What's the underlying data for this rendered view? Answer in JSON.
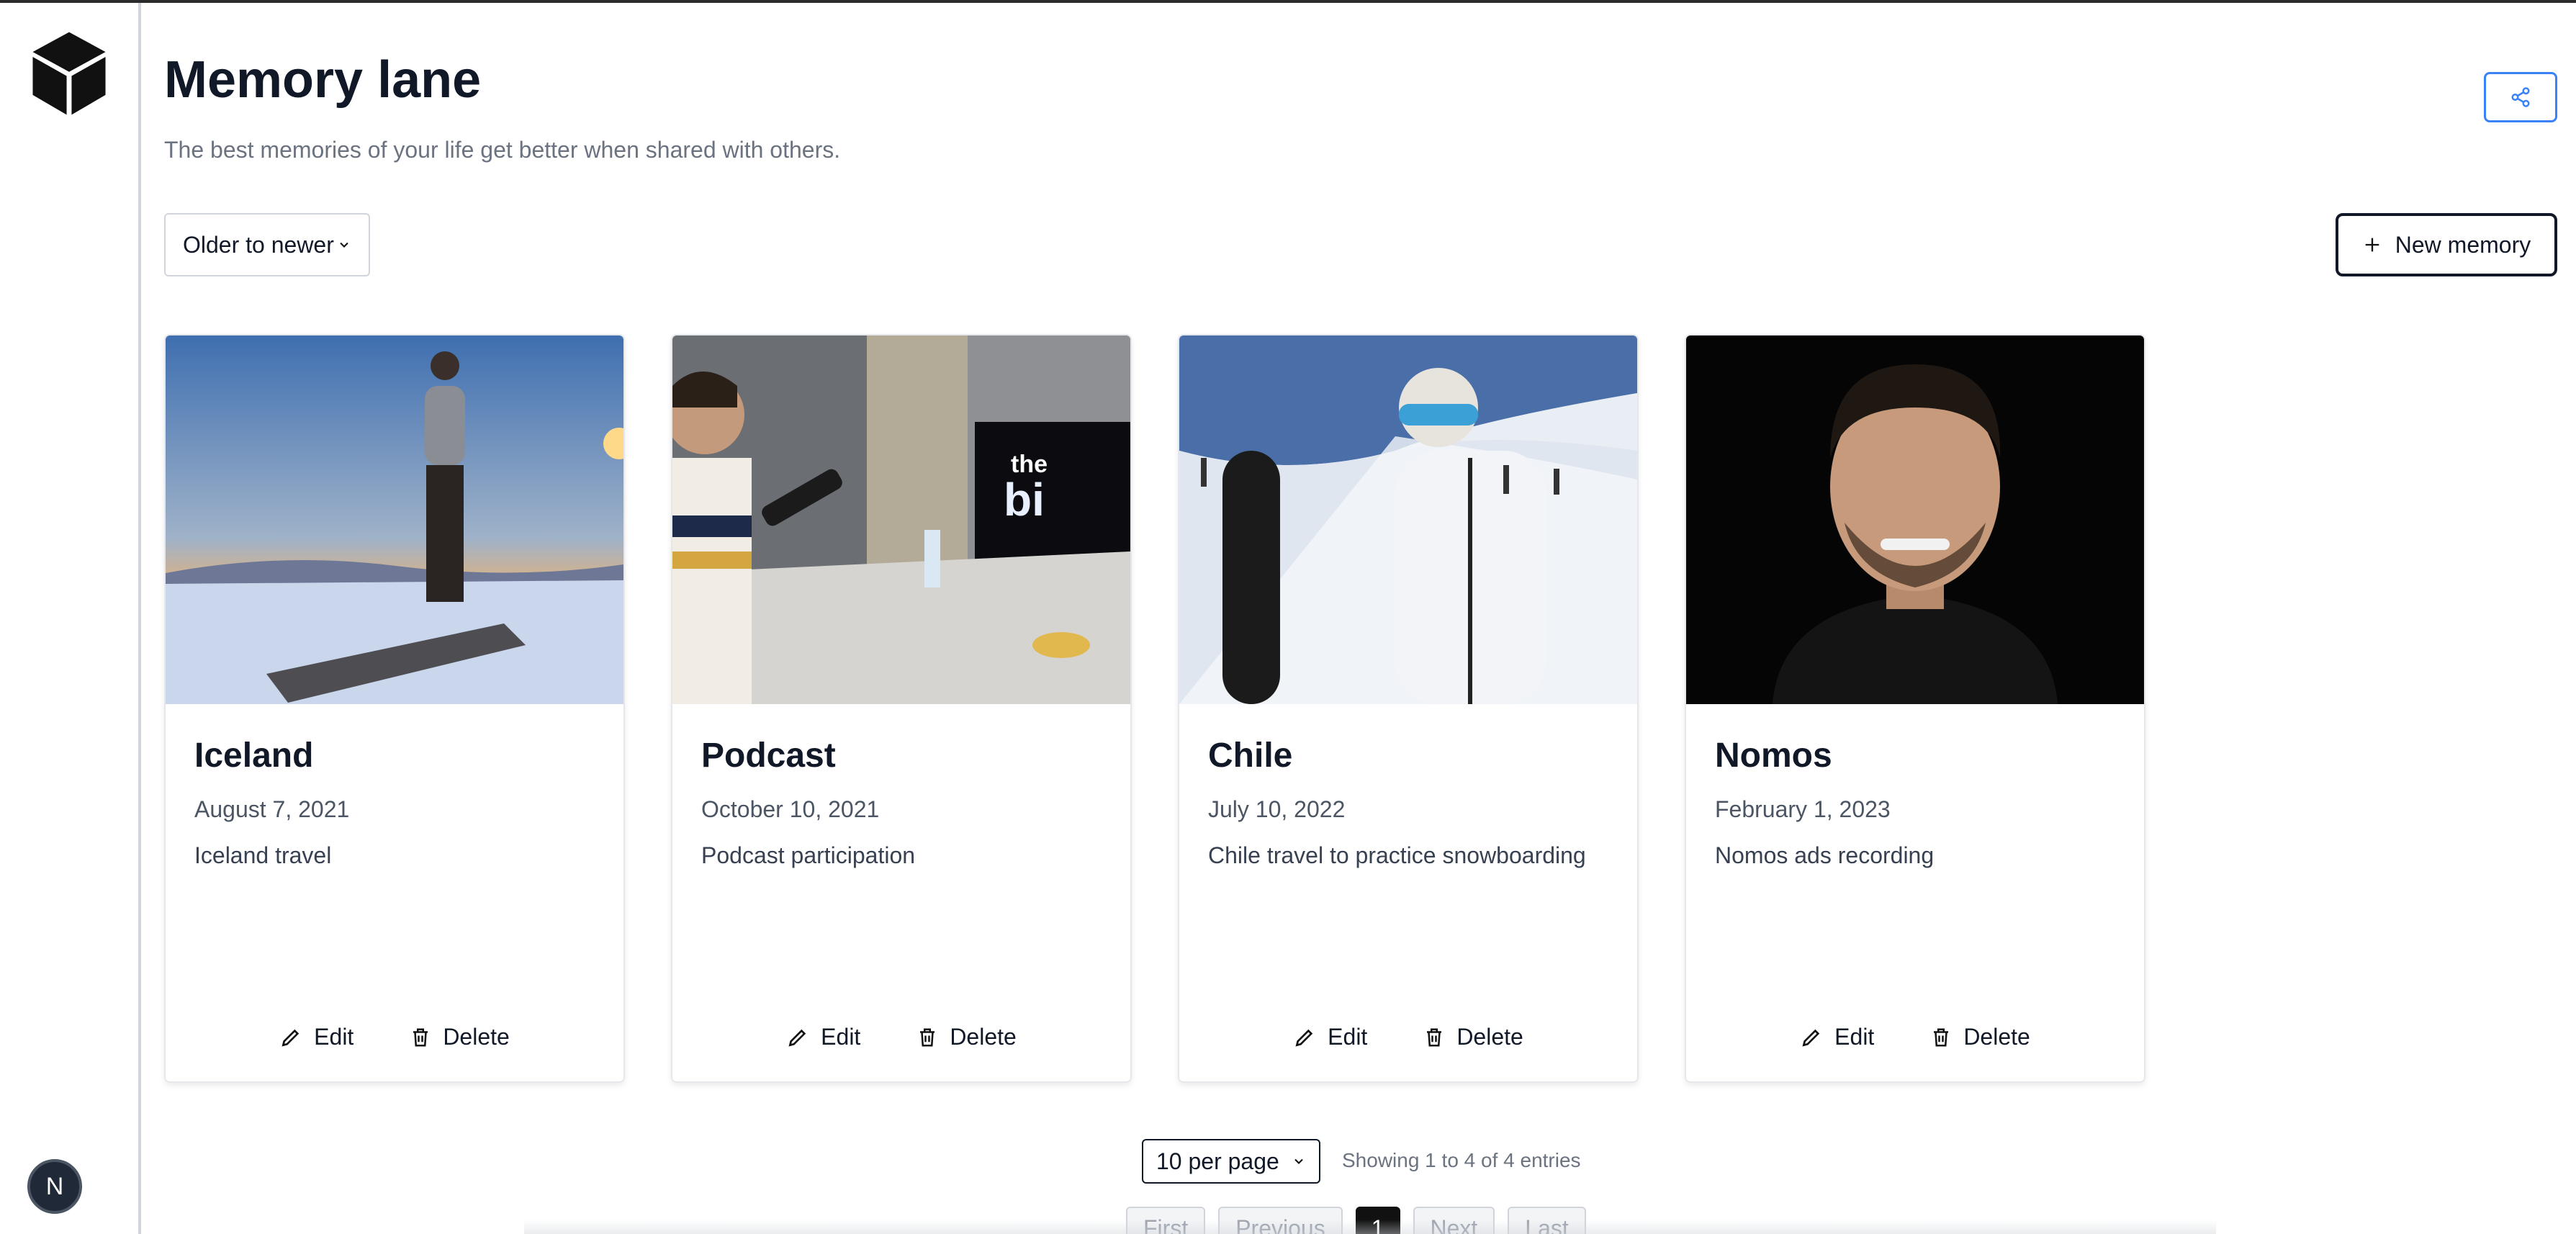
{
  "header": {
    "title": "Memory lane",
    "subtitle": "The best memories of your life get better when shared with others."
  },
  "toolbar": {
    "sort_value": "Older to newer",
    "new_label": "New memory"
  },
  "cards": [
    {
      "title": "Iceland",
      "date": "August 7, 2021",
      "description": "Iceland travel",
      "edit": "Edit",
      "delete": "Delete"
    },
    {
      "title": "Podcast",
      "date": "October 10, 2021",
      "description": "Podcast participation",
      "edit": "Edit",
      "delete": "Delete"
    },
    {
      "title": "Chile",
      "date": "July 10, 2022",
      "description": "Chile travel to practice snowboarding",
      "edit": "Edit",
      "delete": "Delete"
    },
    {
      "title": "Nomos",
      "date": "February 1, 2023",
      "description": "Nomos ads recording",
      "edit": "Edit",
      "delete": "Delete"
    }
  ],
  "pagination": {
    "per_page": "10 per page",
    "showing": "Showing 1 to 4 of 4 entries",
    "first": "First",
    "previous": "Previous",
    "current": "1",
    "next": "Next",
    "last": "Last"
  },
  "badge": {
    "letter": "N"
  },
  "colors": {
    "accent": "#3b82f6",
    "text": "#111827",
    "muted": "#6b7280"
  }
}
